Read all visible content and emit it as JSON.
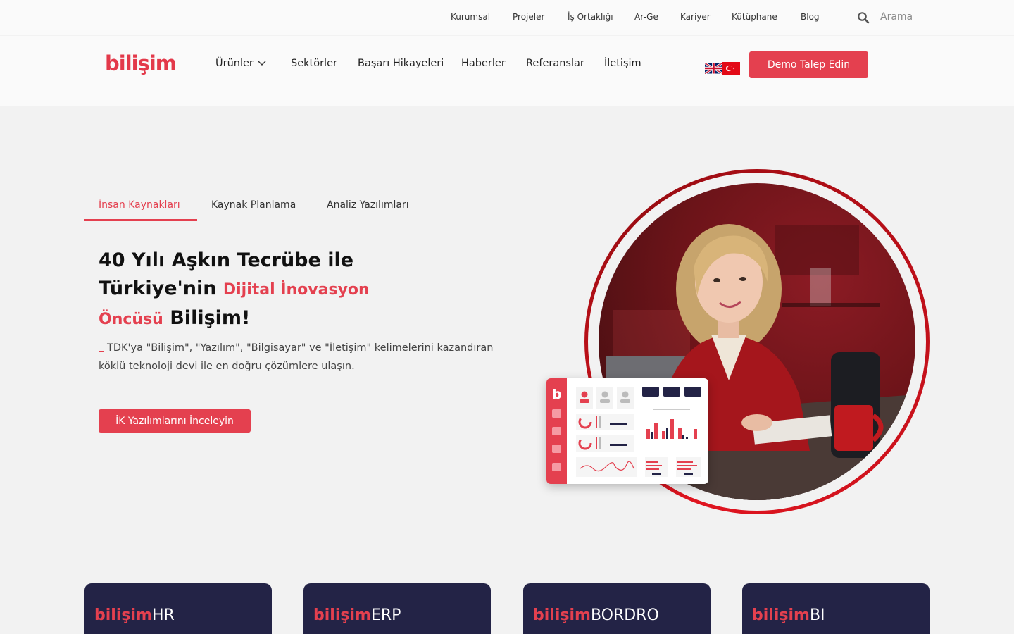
{
  "topbar": {
    "links": [
      "Kurumsal",
      "Projeler",
      "İş Ortaklığı",
      "Ar-Ge",
      "Kariyer",
      "Kütüphane",
      "Blog"
    ],
    "search_placeholder": "Arama"
  },
  "header": {
    "logo": "bilişim",
    "nav": [
      "Ürünler",
      "Sektörler",
      "Başarı Hikayeleri",
      "Haberler",
      "Referanslar",
      "İletişim"
    ],
    "demo_button": "Demo Talep Edin"
  },
  "hero": {
    "tabs": [
      "İnsan Kaynakları",
      "Kaynak Planlama",
      "Analiz Yazılımları"
    ],
    "active_tab": 0,
    "headline": {
      "line1": "40 Yılı Aşkın Tecrübe ile",
      "line2a": "Türkiye'nin ",
      "line2b": "Dijital İnovasyon",
      "line3a": "Öncüsü",
      "line3b": " Bilişim!"
    },
    "description": "TDK'ya \"Bilişim\", \"Yazılım\", \"Bilgisayar\" ve \"İletişim\" kelimelerini kazandıran köklü teknoloji devi ile en doğru çözümlere ulaşın.",
    "cta": "İK Yazılımlarını İnceleyin",
    "dash_logo": "b"
  },
  "products": [
    {
      "brand": "bilişim",
      "suffix": "HR"
    },
    {
      "brand": "bilişim",
      "suffix": "ERP"
    },
    {
      "brand": "bilişim",
      "suffix": "BORDRO"
    },
    {
      "brand": "bilişim",
      "suffix": "BI"
    }
  ],
  "colors": {
    "accent": "#e4404f",
    "card_bg": "#232346",
    "ring": "#c0101a"
  }
}
